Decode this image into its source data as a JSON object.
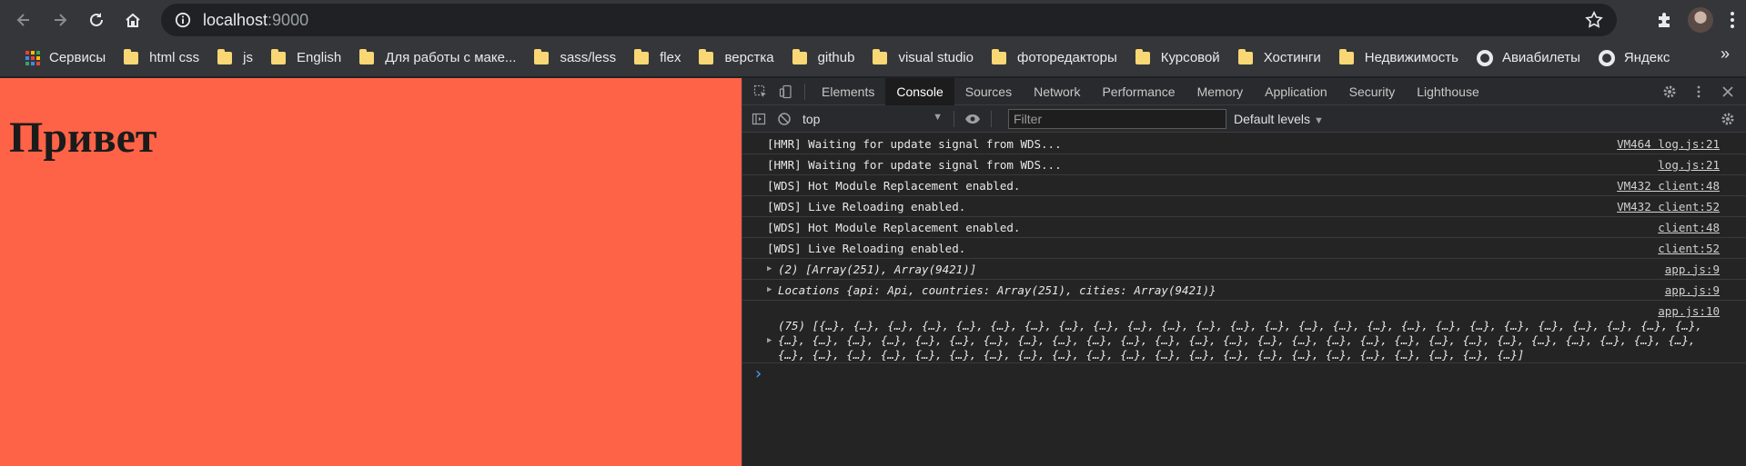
{
  "address_bar": {
    "host": "localhost",
    "port": ":9000"
  },
  "bookmarks": {
    "items": [
      {
        "label": "Сервисы",
        "icon": "apps-icon"
      },
      {
        "label": "html css",
        "icon": "folder-icon"
      },
      {
        "label": "js",
        "icon": "folder-icon"
      },
      {
        "label": "English",
        "icon": "folder-icon"
      },
      {
        "label": "Для работы с маке...",
        "icon": "folder-icon"
      },
      {
        "label": "sass/less",
        "icon": "folder-icon"
      },
      {
        "label": "flex",
        "icon": "folder-icon"
      },
      {
        "label": "верстка",
        "icon": "folder-icon"
      },
      {
        "label": "github",
        "icon": "folder-icon"
      },
      {
        "label": "visual studio",
        "icon": "folder-icon"
      },
      {
        "label": "фоторедакторы",
        "icon": "folder-icon"
      },
      {
        "label": "Курсовой",
        "icon": "folder-icon"
      },
      {
        "label": "Хостинги",
        "icon": "folder-icon"
      },
      {
        "label": "Недвижимость",
        "icon": "folder-icon"
      },
      {
        "label": "Авиабилеты",
        "icon": "globe-icon"
      },
      {
        "label": "Яндекс",
        "icon": "globe-icon"
      }
    ],
    "more": "»"
  },
  "page": {
    "heading": "Привет",
    "background": "#ff6347"
  },
  "devtools": {
    "tabs": [
      "Elements",
      "Console",
      "Sources",
      "Network",
      "Performance",
      "Memory",
      "Application",
      "Security",
      "Lighthouse"
    ],
    "active_tab": "Console",
    "context": "top",
    "filter_placeholder": "Filter",
    "levels": "Default levels",
    "messages": [
      {
        "text": "[HMR] Waiting for update signal from WDS...",
        "source": "VM464 log.js:21"
      },
      {
        "text": "[HMR] Waiting for update signal from WDS...",
        "source": "log.js:21"
      },
      {
        "text": "[WDS] Hot Module Replacement enabled.",
        "source": "VM432 client:48"
      },
      {
        "text": "[WDS] Live Reloading enabled.",
        "source": "VM432 client:52"
      },
      {
        "text": "[WDS] Hot Module Replacement enabled.",
        "source": "client:48"
      },
      {
        "text": "[WDS] Live Reloading enabled.",
        "source": "client:52"
      },
      {
        "text": "(2) [Array(251), Array(9421)]",
        "source": "app.js:9"
      },
      {
        "text": "Locations {api: Api, countries: Array(251), cities: Array(9421)}",
        "source": "app.js:9"
      },
      {
        "text": "(75) [{…}, {…}, {…}, {…}, {…}, {…}, {…}, {…}, {…}, {…}, {…}, {…}, {…}, {…}, {…}, {…}, {…}, {…}, {…}, {…}, {…}, {…}, {…}, {…}, {…}, {…}, {…}, {…}, {…}, {…}, {…}, {…}, {…}, {…}, {…}, {…}, {…}, {…}, {…}, {…}, {…}, {…}, {…}, {…}, {…}, {…}, {…}, {…}, {…}, {…}, {…}, {…}, {…}, {…}, {…}, {…}, {…}, {…}, {…}, {…}, {…}, {…}, {…}, {…}, {…}, {…}, {…}, {…}, {…}, {…}, {…}, {…}, {…}, {…}, {…}]",
        "source": "app.js:10"
      }
    ],
    "prompt": "›"
  }
}
